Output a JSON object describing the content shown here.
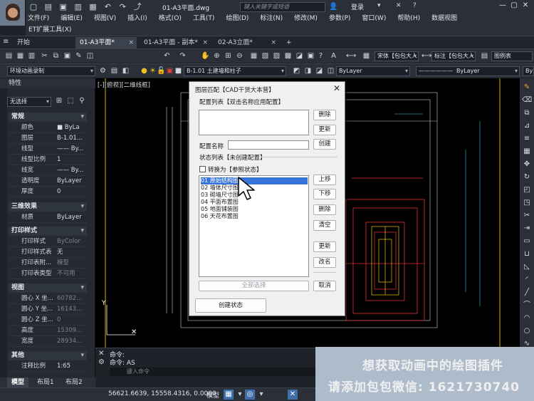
{
  "titlebar": {
    "doc_title": "01-A3平面.dwg",
    "search_placeholder": "键入关键字或短语",
    "login": "登录"
  },
  "menu": [
    "文件(F)",
    "编辑(E)",
    "视图(V)",
    "插入(I)",
    "格式(O)",
    "工具(T)",
    "绘图(D)",
    "标注(N)",
    "修改(M)",
    "参数(P)",
    "窗口(W)",
    "帮助(H)",
    "数据视图"
  ],
  "menu2": "ET扩展工具(X)",
  "tabs": [
    "开始",
    "01-A3平面*",
    "01-A3平面 - 副本*",
    "02-A3立面*"
  ],
  "toolbar": {
    "text_style": "宋体【包包大人",
    "dim_style_label": "标注【包包大人",
    "legend": "图例表",
    "workspace": "环境动画录制",
    "layer": "B-1.01 土建墙和柱子",
    "bylayer1": "ByLayer",
    "bylayer2": "ByLayer",
    "bylayer3": "ByL"
  },
  "properties": {
    "title": "特性",
    "selection": "无选择",
    "sections": [
      {
        "name": "常规",
        "rows": [
          {
            "k": "颜色",
            "v": "■ ByLa"
          },
          {
            "k": "图层",
            "v": "B-1.01..."
          },
          {
            "k": "线型",
            "v": "—— By..."
          },
          {
            "k": "线型比例",
            "v": "1"
          },
          {
            "k": "线宽",
            "v": "—— By..."
          },
          {
            "k": "透明度",
            "v": "ByLayer"
          },
          {
            "k": "厚度",
            "v": "0"
          }
        ]
      },
      {
        "name": "三维效果",
        "rows": [
          {
            "k": "材质",
            "v": "ByLayer"
          }
        ]
      },
      {
        "name": "打印样式",
        "rows": [
          {
            "k": "打印样式",
            "v": "ByColor",
            "dim": true
          },
          {
            "k": "打印样式表",
            "v": "无"
          },
          {
            "k": "打印表附...",
            "v": "模型",
            "dim": true
          },
          {
            "k": "打印表类型",
            "v": "不可用",
            "dim": true
          }
        ]
      },
      {
        "name": "视图",
        "rows": [
          {
            "k": "圆心 X 坐...",
            "v": "60782...",
            "dim": true
          },
          {
            "k": "圆心 Y 坐...",
            "v": "16143...",
            "dim": true
          },
          {
            "k": "圆心 Z 坐...",
            "v": "0",
            "dim": true
          },
          {
            "k": "高度",
            "v": "15309...",
            "dim": true
          },
          {
            "k": "宽度",
            "v": "28934...",
            "dim": true
          }
        ]
      },
      {
        "name": "其他",
        "rows": [
          {
            "k": "注释比例",
            "v": "1:65"
          }
        ]
      }
    ]
  },
  "viewport_label": "[-][俯视][二维线框]",
  "dialog": {
    "title": "图层匹配【CAD干货大本营】",
    "config_list_label": "配置列表【双击名称应用配置】",
    "config_name_label": "配置名称",
    "state_list_label": "状态列表【未创建配置】",
    "convert_checkbox": "转换为【参照状态】",
    "items": [
      "01 原始结构图",
      "02 墙体尺寸图",
      "03 砌墙尺寸图",
      "04 平面布置图",
      "05 地面铺装图",
      "06 天花布置图"
    ],
    "btn_delete": "删除",
    "btn_update": "更新",
    "btn_create": "创建",
    "btn_up": "上移",
    "btn_down": "下移",
    "btn_delete2": "删除",
    "btn_clear": "清空",
    "btn_update2": "更新",
    "btn_rename": "改名",
    "btn_select_all": "全部选择",
    "btn_cancel": "取消",
    "btn_create_state": "创建状态"
  },
  "command": {
    "line1": "命令:",
    "line2": "命令: AS",
    "input_placeholder": "键入命令"
  },
  "layout_tabs": [
    "模型",
    "布局1",
    "布局2"
  ],
  "status": {
    "coords": "56621.6639, 15558.4316, 0.0000",
    "model": "模型"
  },
  "banner": {
    "line1": "想获取动画中的绘图插件",
    "line2": "请添加包包微信: 1621730740"
  }
}
